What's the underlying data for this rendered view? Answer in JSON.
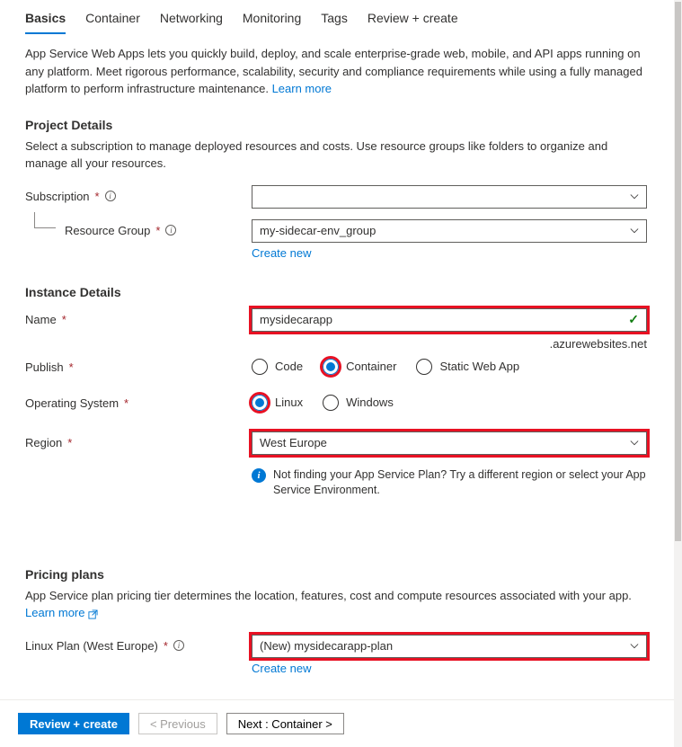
{
  "tabs": {
    "basics": "Basics",
    "container": "Container",
    "networking": "Networking",
    "monitoring": "Monitoring",
    "tags": "Tags",
    "review": "Review + create"
  },
  "intro": {
    "text": "App Service Web Apps lets you quickly build, deploy, and scale enterprise-grade web, mobile, and API apps running on any platform. Meet rigorous performance, scalability, security and compliance requirements while using a fully managed platform to perform infrastructure maintenance.  ",
    "learn_more": "Learn more"
  },
  "project_details": {
    "title": "Project Details",
    "desc": "Select a subscription to manage deployed resources and costs. Use resource groups like folders to organize and manage all your resources.",
    "subscription_label": "Subscription",
    "subscription_value": "",
    "resource_group_label": "Resource Group",
    "resource_group_value": "my-sidecar-env_group",
    "create_new": "Create new"
  },
  "instance": {
    "title": "Instance Details",
    "name_label": "Name",
    "name_value": "mysidecarapp",
    "domain_suffix": ".azurewebsites.net",
    "publish_label": "Publish",
    "publish_options": {
      "code": "Code",
      "container": "Container",
      "swa": "Static Web App"
    },
    "os_label": "Operating System",
    "os_options": {
      "linux": "Linux",
      "windows": "Windows"
    },
    "region_label": "Region",
    "region_value": "West Europe",
    "region_hint": "Not finding your App Service Plan? Try a different region or select your App Service Environment."
  },
  "pricing": {
    "title": "Pricing plans",
    "desc": "App Service plan pricing tier determines the location, features, cost and compute resources associated with your app. ",
    "learn_more": "Learn more",
    "plan_label": "Linux Plan (West Europe)",
    "plan_value": "(New) mysidecarapp-plan",
    "create_new": "Create new"
  },
  "footer": {
    "review": "Review + create",
    "previous": "< Previous",
    "next": "Next : Container >"
  }
}
